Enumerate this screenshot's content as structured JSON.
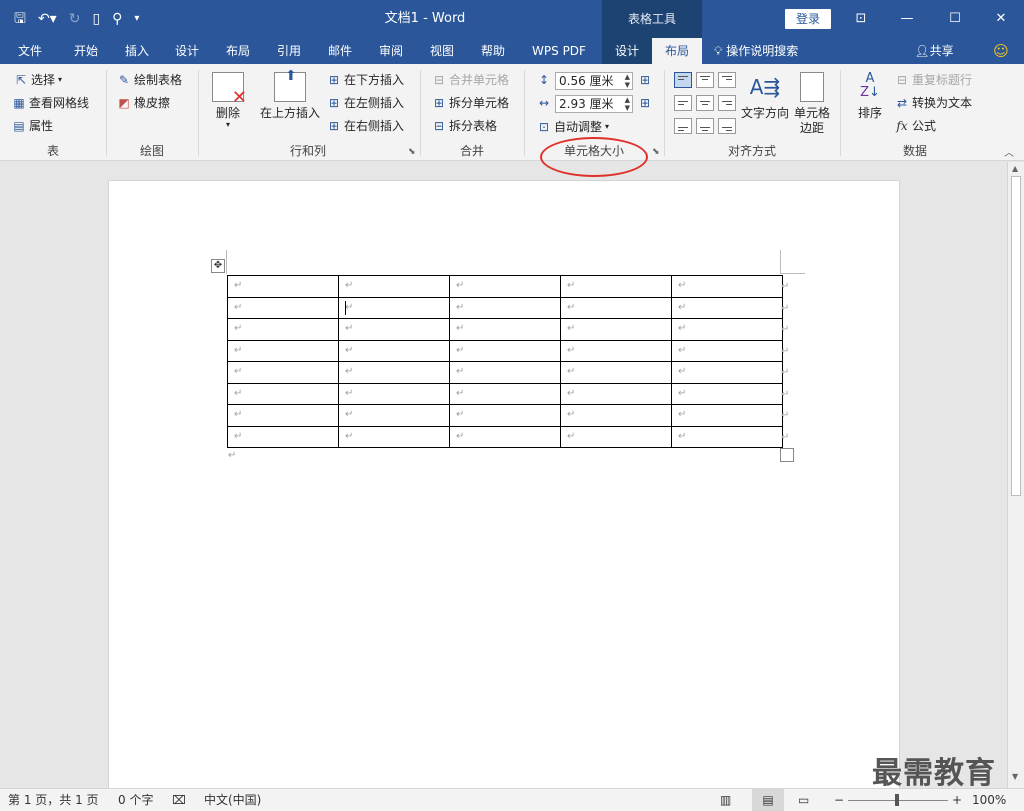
{
  "window": {
    "title": "文档1  -  Word",
    "context_tools_label": "表格工具",
    "login_label": "登录"
  },
  "tabs": [
    "文件",
    "开始",
    "插入",
    "设计",
    "布局",
    "引用",
    "邮件",
    "审阅",
    "视图",
    "帮助",
    "WPS PDF",
    "设计",
    "布局"
  ],
  "tellme": "操作说明搜索",
  "share": "共享",
  "ribbon": {
    "table": {
      "select": "选择",
      "gridlines": "查看网格线",
      "properties": "属性",
      "label": "表"
    },
    "draw": {
      "draw_table": "绘制表格",
      "eraser": "橡皮擦",
      "label": "绘图"
    },
    "rowscols": {
      "delete": "删除",
      "insert_above": "在上方插入",
      "insert_below": "在下方插入",
      "insert_left": "在左侧插入",
      "insert_right": "在右侧插入",
      "label": "行和列"
    },
    "merge": {
      "merge_cells": "合并单元格",
      "split_cells": "拆分单元格",
      "split_table": "拆分表格",
      "label": "合并"
    },
    "cellsize": {
      "height": "0.56 厘米",
      "width": "2.93 厘米",
      "autofit": "自动调整",
      "label": "单元格大小"
    },
    "alignment": {
      "text_direction": "文字方向",
      "cell_margins_line1": "单元格",
      "cell_margins_line2": "边距",
      "label": "对齐方式"
    },
    "data": {
      "sort": "排序",
      "repeat_header": "重复标题行",
      "convert_text": "转换为文本",
      "formula": "公式",
      "label": "数据"
    }
  },
  "table": {
    "rows": 8,
    "cols": 5,
    "cell_mark": "↵"
  },
  "status": {
    "page": "第 1 页，共 1 页",
    "words": "0 个字",
    "language": "中文(中国)",
    "zoom": "100%"
  },
  "watermark": "最需教育"
}
